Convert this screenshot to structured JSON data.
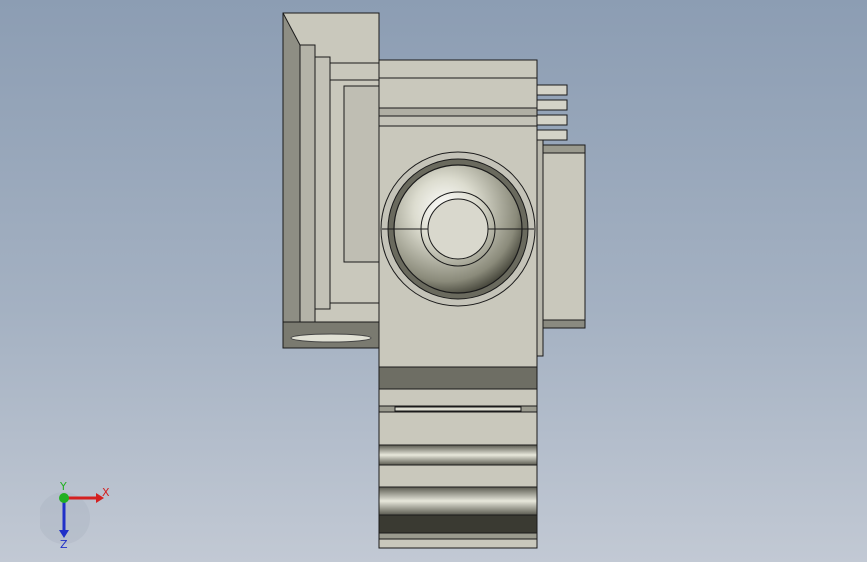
{
  "viewport": {
    "background_top": "#8c9db3",
    "background_bottom": "#c2c9d4"
  },
  "model": {
    "body_color": "#c9c8bc",
    "shade_color": "#8a8a80",
    "edge_color": "#1a1a1a"
  },
  "triad": {
    "x_label": "X",
    "y_label": "Y",
    "z_label": "Z",
    "x_color": "#d42020",
    "y_color": "#22b022",
    "z_color": "#2030c8"
  }
}
